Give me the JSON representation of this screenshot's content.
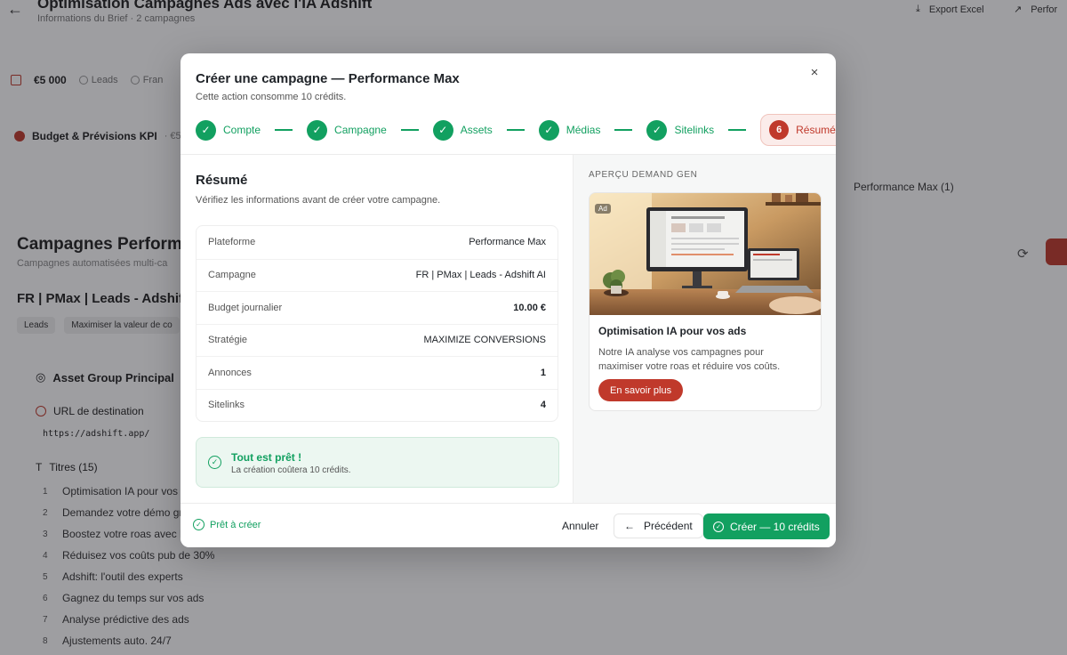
{
  "background": {
    "title": "Optimisation Campagnes Ads avec l'IA Adshift",
    "subtitle": "Informations du Brief · 2 campagnes",
    "export_label": "Export Excel",
    "perf_label": "Perfor",
    "metrics": {
      "budget": "€5 000",
      "leads": "Leads",
      "lang": "Fran"
    },
    "kpi_title": "Budget & Prévisions KPI",
    "kpi_value": "· €50",
    "pmax_count": "Performance Max (1)",
    "campaigns_title": "Campagnes Performa",
    "campaigns_sub": "Campagnes automatisées multi-ca",
    "campaign_name": "FR | PMax | Leads - Adshift ",
    "tags": [
      "Leads",
      "Maximiser la valeur de co"
    ],
    "asset_group": "Asset Group Principal",
    "url_label": "URL de destination",
    "url": "https://adshift.app/",
    "titles_label": "Titres (15)",
    "titles": [
      {
        "n": "1",
        "text": "Optimisation IA pour vos a"
      },
      {
        "n": "2",
        "text": "Demandez votre démo gra"
      },
      {
        "n": "3",
        "text": "Boostez votre roas avec l'"
      },
      {
        "n": "4",
        "text": "Réduisez vos coûts pub de 30%"
      },
      {
        "n": "5",
        "text": "Adshift: l'outil des experts"
      },
      {
        "n": "6",
        "text": "Gagnez du temps sur vos ads"
      },
      {
        "n": "7",
        "text": "Analyse prédictive des ads"
      },
      {
        "n": "8",
        "text": "Ajustements auto. 24/7"
      }
    ]
  },
  "modal": {
    "title": "Créer une campagne — Performance Max",
    "subtitle": "Cette action consomme 10 crédits.",
    "close_icon": "×",
    "steps": [
      {
        "label": "Compte",
        "marker": "✓"
      },
      {
        "label": "Campagne",
        "marker": "✓"
      },
      {
        "label": "Assets",
        "marker": "✓"
      },
      {
        "label": "Médias",
        "marker": "✓"
      },
      {
        "label": "Sitelinks",
        "marker": "✓"
      },
      {
        "label": "Résumé",
        "marker": "6"
      }
    ],
    "summary_title": "Résumé",
    "summary_subtitle": "Vérifiez les informations avant de créer votre campagne.",
    "rows": [
      {
        "label": "Plateforme",
        "value": "Performance Max"
      },
      {
        "label": "Campagne",
        "value": "FR | PMax | Leads - Adshift AI"
      },
      {
        "label": "Budget journalier",
        "value": "10.00 €"
      },
      {
        "label": "Stratégie",
        "value": "MAXIMIZE CONVERSIONS"
      },
      {
        "label": "Annonces",
        "value": "1"
      },
      {
        "label": "Sitelinks",
        "value": "4"
      }
    ],
    "ready": {
      "title": "Tout est prêt !",
      "subtitle": "La création coûtera 10 crédits."
    },
    "preview": {
      "label": "APERÇU DEMAND GEN",
      "badge": "Ad",
      "title": "Optimisation IA pour vos ads",
      "description": "Notre IA analyse vos campagnes pour maximiser votre roas et réduire vos coûts.",
      "cta": "En savoir plus"
    },
    "footer": {
      "status": "Prêt à créer",
      "cancel": "Annuler",
      "previous": "Précédent",
      "create": "Créer — 10 crédits"
    }
  },
  "colors": {
    "success": "#12a060",
    "brand": "#c0392b"
  }
}
